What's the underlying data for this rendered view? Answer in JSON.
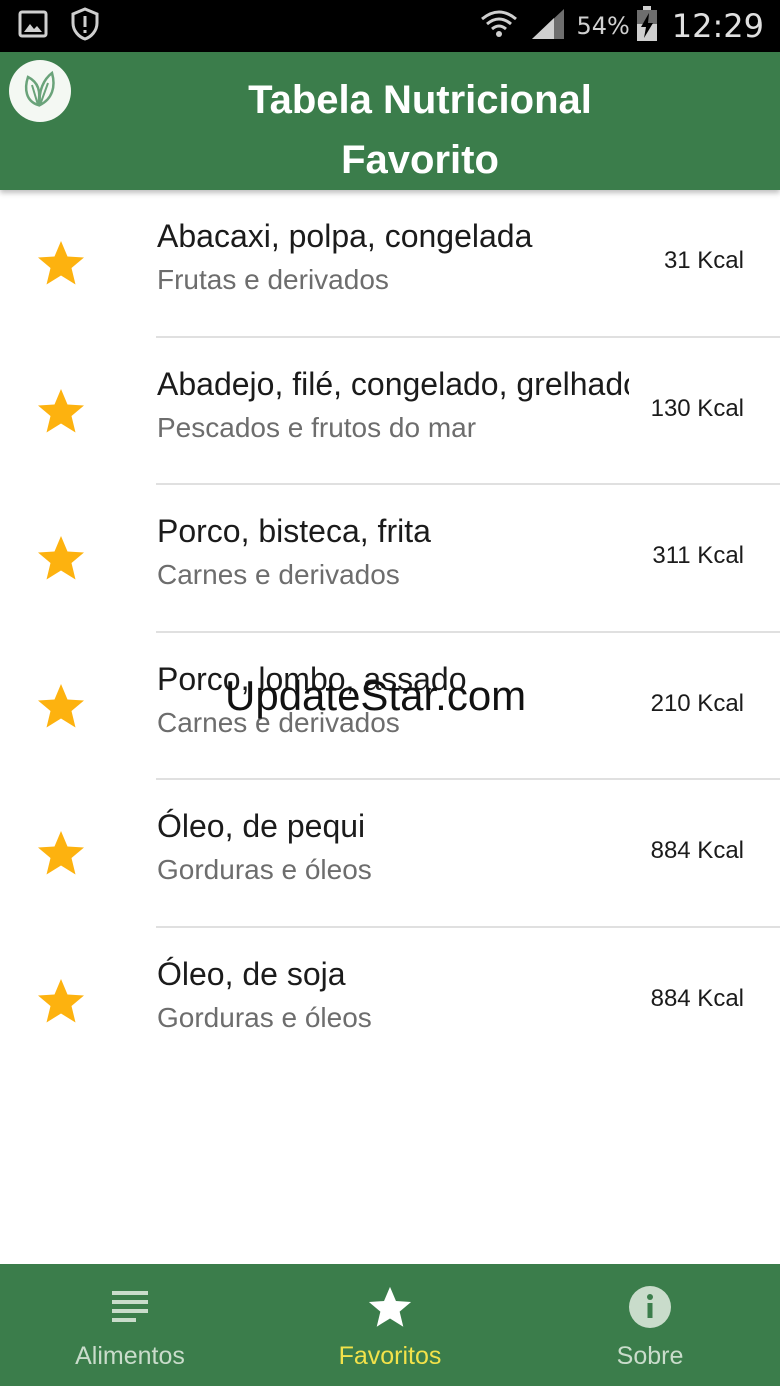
{
  "status_bar": {
    "battery": "54%",
    "time": "12:29",
    "icons": [
      "image-icon",
      "shield-alert-icon",
      "wifi-icon",
      "signal-icon",
      "battery-charging-icon"
    ]
  },
  "app_bar": {
    "title": "Tabela Nutricional",
    "subtitle": "Favorito",
    "logo_icon": "leaf-icon"
  },
  "favorites": [
    {
      "name": "Abacaxi, polpa, congelada",
      "category": "Frutas e derivados",
      "kcal": "31 Kcal"
    },
    {
      "name": "Abadejo, filé, congelado, grelhado",
      "category": "Pescados e frutos do mar",
      "kcal": "130 Kcal"
    },
    {
      "name": "Porco, bisteca, frita",
      "category": "Carnes e derivados",
      "kcal": "311 Kcal"
    },
    {
      "name": "Porco, lombo, assado",
      "category": "Carnes e derivados",
      "kcal": "210 Kcal"
    },
    {
      "name": "Óleo, de pequi",
      "category": "Gorduras e óleos",
      "kcal": "884 Kcal"
    },
    {
      "name": "Óleo, de soja",
      "category": "Gorduras e óleos",
      "kcal": "884 Kcal"
    }
  ],
  "watermark": "UpdateStar.com",
  "bottom_nav": {
    "items": [
      {
        "label": "Alimentos",
        "icon": "list-icon",
        "active": false
      },
      {
        "label": "Favoritos",
        "icon": "star-icon",
        "active": true
      },
      {
        "label": "Sobre",
        "icon": "info-icon",
        "active": false
      }
    ]
  },
  "colors": {
    "primary": "#3b7d4b",
    "star": "#fdb20f",
    "active_nav": "#f2e24a",
    "inactive_nav": "#c9dccb"
  }
}
